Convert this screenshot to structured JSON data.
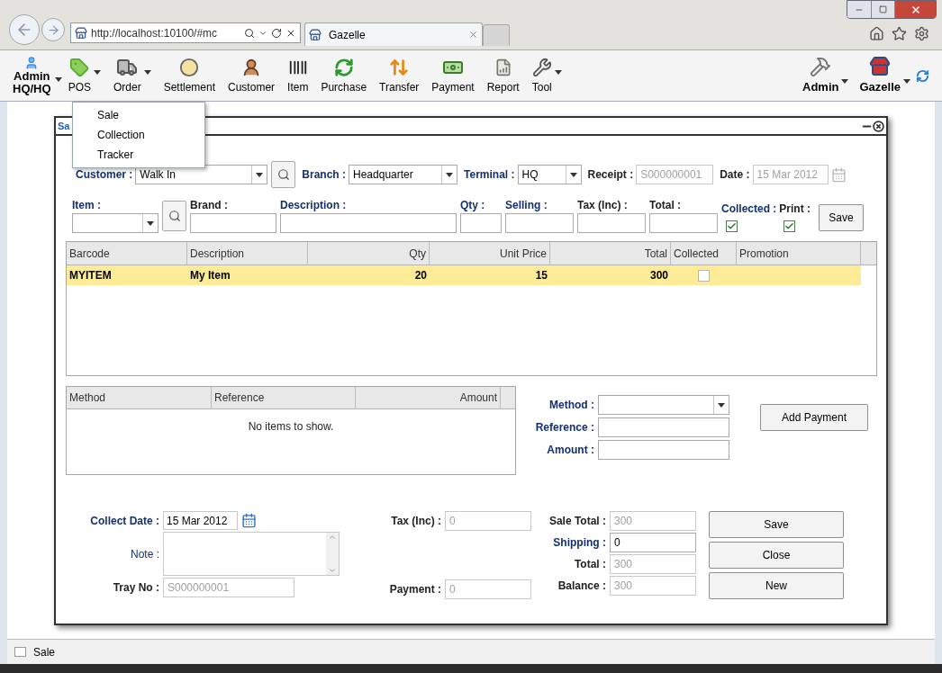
{
  "browser": {
    "address": "http://localhost:10100/#mc",
    "tab": "Gazelle"
  },
  "toolbar": {
    "user": [
      "Admin",
      "HQ/HQ"
    ],
    "items": [
      {
        "label": "POS",
        "menu": true
      },
      {
        "label": "Order",
        "menu": true
      },
      {
        "label": "Settlement",
        "menu": false
      },
      {
        "label": "Customer",
        "menu": false
      },
      {
        "label": "Item",
        "menu": false
      },
      {
        "label": "Purchase",
        "menu": false
      },
      {
        "label": "Transfer",
        "menu": false
      },
      {
        "label": "Payment",
        "menu": false
      },
      {
        "label": "Report",
        "menu": false
      },
      {
        "label": "Tool",
        "menu": true
      }
    ],
    "right": [
      {
        "label": "Admin",
        "menu": true
      },
      {
        "label": "Gazelle",
        "menu": true
      }
    ]
  },
  "open_menu": [
    {
      "label": "Sale"
    },
    {
      "label": "Collection"
    },
    {
      "label": "Tracker"
    }
  ],
  "dialog": {
    "title": "Sa",
    "header": [
      {
        "label": "Customer :",
        "value": "Walk In",
        "kind": "combo",
        "search": true,
        "required": true,
        "disabled": false
      },
      {
        "label": "Branch :",
        "value": "Headquarter",
        "kind": "combo",
        "search": false,
        "required": true,
        "disabled": false
      },
      {
        "label": "Terminal :",
        "value": "HQ",
        "kind": "combo",
        "search": false,
        "required": true,
        "disabled": false
      },
      {
        "label": "Receipt :",
        "value": "S000000001",
        "kind": "text",
        "search": false,
        "required": false,
        "disabled": true
      },
      {
        "label": "Date :",
        "value": "15 Mar 2012",
        "kind": "date",
        "search": false,
        "required": false,
        "disabled": true
      }
    ],
    "item_entry": [
      {
        "label": "Item :",
        "kind": "combo",
        "search": true,
        "required": true
      },
      {
        "label": "Brand :",
        "kind": "text",
        "required": false
      },
      {
        "label": "Description :",
        "kind": "text",
        "required": true
      },
      {
        "label": "Qty :",
        "kind": "text",
        "required": true
      },
      {
        "label": "Selling :",
        "kind": "text",
        "required": true
      },
      {
        "label": "Tax (Inc) :",
        "kind": "text",
        "required": false
      },
      {
        "label": "Total :",
        "kind": "text",
        "required": false
      },
      {
        "label": "Collected :",
        "kind": "check",
        "checked": true,
        "required": true
      },
      {
        "label": "Print :",
        "kind": "check",
        "checked": true,
        "required": false
      }
    ],
    "item_save": "Save",
    "items_table": {
      "columns": [
        "Barcode",
        "Description",
        "Qty",
        "Unit Price",
        "Total",
        "Collected",
        "Promotion"
      ],
      "rows": [
        {
          "cells": [
            "MYITEM",
            "My Item",
            "20",
            "15",
            "300"
          ],
          "collected": false,
          "selected": true
        }
      ]
    },
    "payments_table": {
      "columns": [
        "Method",
        "Reference",
        "Amount"
      ],
      "empty": "No items to show."
    },
    "payment_form": {
      "fields": [
        {
          "label": "Method :",
          "kind": "combo",
          "required": true
        },
        {
          "label": "Reference :",
          "kind": "text",
          "required": true
        },
        {
          "label": "Amount :",
          "kind": "text",
          "required": true
        }
      ],
      "button": "Add Payment"
    },
    "footer": {
      "collect_date": {
        "label": "Collect Date :",
        "value": "15 Mar 2012",
        "required": true
      },
      "note": {
        "label": "Note :",
        "required": true
      },
      "tray_no": {
        "label": "Tray No :",
        "value": "S000000001",
        "required": false,
        "disabled": true
      },
      "tax": {
        "label": "Tax (Inc) :",
        "value": "0",
        "required": false,
        "disabled": true
      },
      "payment": {
        "label": "Payment :",
        "value": "0",
        "required": false,
        "disabled": true
      },
      "totals": [
        {
          "label": "Sale Total :",
          "value": "300",
          "required": false,
          "disabled": true
        },
        {
          "label": "Shipping :",
          "value": "0",
          "required": true,
          "disabled": false
        },
        {
          "label": "Total :",
          "value": "300",
          "required": false,
          "disabled": true
        },
        {
          "label": "Balance :",
          "value": "300",
          "required": false,
          "disabled": true
        }
      ],
      "buttons": [
        "Save",
        "Close",
        "New"
      ]
    }
  },
  "status_bar": {
    "label": "Sale"
  }
}
